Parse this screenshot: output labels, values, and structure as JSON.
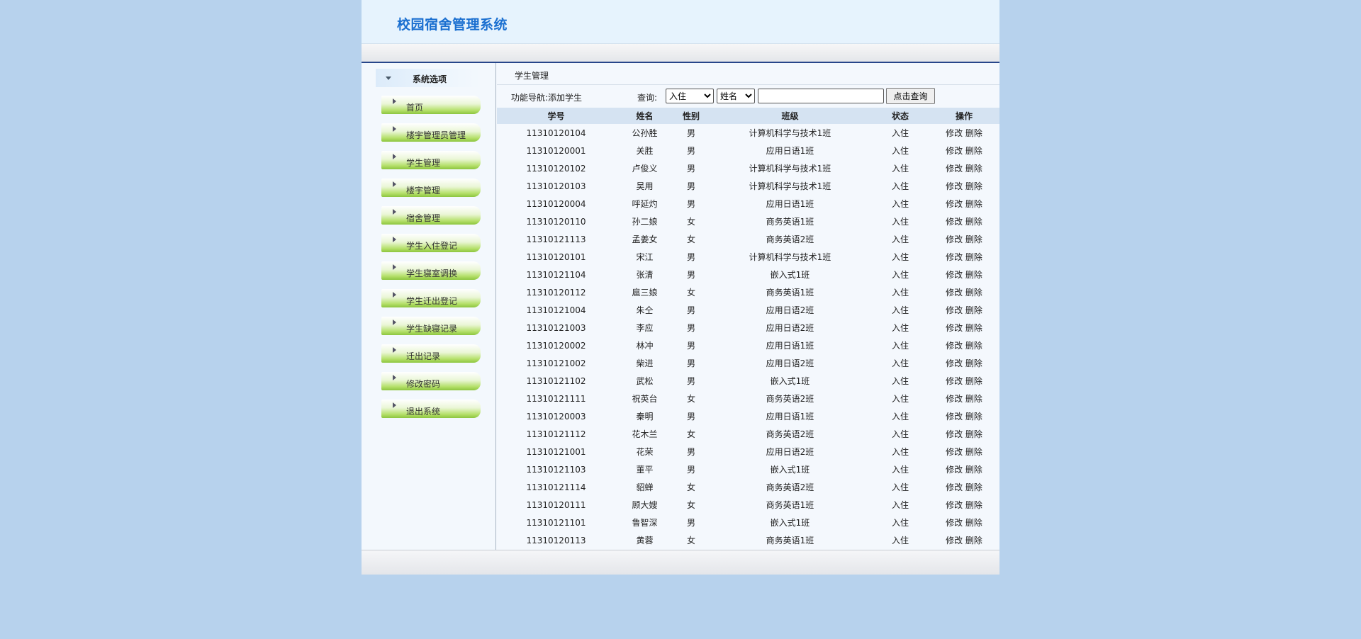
{
  "app": {
    "title": "校园宿舍管理系统"
  },
  "sidebar": {
    "header": "系统选项",
    "items": [
      {
        "label": "首页"
      },
      {
        "label": "楼宇管理员管理"
      },
      {
        "label": "学生管理"
      },
      {
        "label": "楼宇管理"
      },
      {
        "label": "宿舍管理"
      },
      {
        "label": "学生入住登记"
      },
      {
        "label": "学生寝室调换"
      },
      {
        "label": "学生迁出登记"
      },
      {
        "label": "学生缺寝记录"
      },
      {
        "label": "迁出记录"
      },
      {
        "label": "修改密码"
      },
      {
        "label": "退出系统"
      }
    ]
  },
  "main": {
    "breadcrumb": "学生管理",
    "nav_text": "功能导航:添加学生",
    "query_label": "查询:",
    "status_select": {
      "selected": "入住",
      "options": [
        "入住"
      ]
    },
    "field_select": {
      "selected": "姓名",
      "options": [
        "姓名"
      ]
    },
    "search_value": "",
    "search_button": "点击查询"
  },
  "table": {
    "headers": [
      "学号",
      "姓名",
      "性别",
      "班级",
      "状态",
      "操作"
    ],
    "edit_label": "修改",
    "delete_label": "删除",
    "rows": [
      {
        "id": "11310120104",
        "name": "公孙胜",
        "gender": "男",
        "class": "计算机科学与技术1班",
        "status": "入住"
      },
      {
        "id": "11310120001",
        "name": "关胜",
        "gender": "男",
        "class": "应用日语1班",
        "status": "入住"
      },
      {
        "id": "11310120102",
        "name": "卢俊义",
        "gender": "男",
        "class": "计算机科学与技术1班",
        "status": "入住"
      },
      {
        "id": "11310120103",
        "name": "吴用",
        "gender": "男",
        "class": "计算机科学与技术1班",
        "status": "入住"
      },
      {
        "id": "11310120004",
        "name": "呼延灼",
        "gender": "男",
        "class": "应用日语1班",
        "status": "入住"
      },
      {
        "id": "11310120110",
        "name": "孙二娘",
        "gender": "女",
        "class": "商务英语1班",
        "status": "入住"
      },
      {
        "id": "11310121113",
        "name": "孟姜女",
        "gender": "女",
        "class": "商务英语2班",
        "status": "入住"
      },
      {
        "id": "11310120101",
        "name": "宋江",
        "gender": "男",
        "class": "计算机科学与技术1班",
        "status": "入住"
      },
      {
        "id": "11310121104",
        "name": "张清",
        "gender": "男",
        "class": "嵌入式1班",
        "status": "入住"
      },
      {
        "id": "11310120112",
        "name": "扈三娘",
        "gender": "女",
        "class": "商务英语1班",
        "status": "入住"
      },
      {
        "id": "11310121004",
        "name": "朱仝",
        "gender": "男",
        "class": "应用日语2班",
        "status": "入住"
      },
      {
        "id": "11310121003",
        "name": "李应",
        "gender": "男",
        "class": "应用日语2班",
        "status": "入住"
      },
      {
        "id": "11310120002",
        "name": "林冲",
        "gender": "男",
        "class": "应用日语1班",
        "status": "入住"
      },
      {
        "id": "11310121002",
        "name": "柴进",
        "gender": "男",
        "class": "应用日语2班",
        "status": "入住"
      },
      {
        "id": "11310121102",
        "name": "武松",
        "gender": "男",
        "class": "嵌入式1班",
        "status": "入住"
      },
      {
        "id": "11310121111",
        "name": "祝英台",
        "gender": "女",
        "class": "商务英语2班",
        "status": "入住"
      },
      {
        "id": "11310120003",
        "name": "秦明",
        "gender": "男",
        "class": "应用日语1班",
        "status": "入住"
      },
      {
        "id": "11310121112",
        "name": "花木兰",
        "gender": "女",
        "class": "商务英语2班",
        "status": "入住"
      },
      {
        "id": "11310121001",
        "name": "花荣",
        "gender": "男",
        "class": "应用日语2班",
        "status": "入住"
      },
      {
        "id": "11310121103",
        "name": "董平",
        "gender": "男",
        "class": "嵌入式1班",
        "status": "入住"
      },
      {
        "id": "11310121114",
        "name": "貂蝉",
        "gender": "女",
        "class": "商务英语2班",
        "status": "入住"
      },
      {
        "id": "11310120111",
        "name": "顾大嫂",
        "gender": "女",
        "class": "商务英语1班",
        "status": "入住"
      },
      {
        "id": "11310121101",
        "name": "鲁智深",
        "gender": "男",
        "class": "嵌入式1班",
        "status": "入住"
      },
      {
        "id": "11310120113",
        "name": "黄蓉",
        "gender": "女",
        "class": "商务英语1班",
        "status": "入住"
      }
    ]
  },
  "colors": {
    "background": "#b7d2ed",
    "title": "#1a6fd0",
    "table_header": "#d5e3f2",
    "menu_green": "#8cc63f"
  }
}
